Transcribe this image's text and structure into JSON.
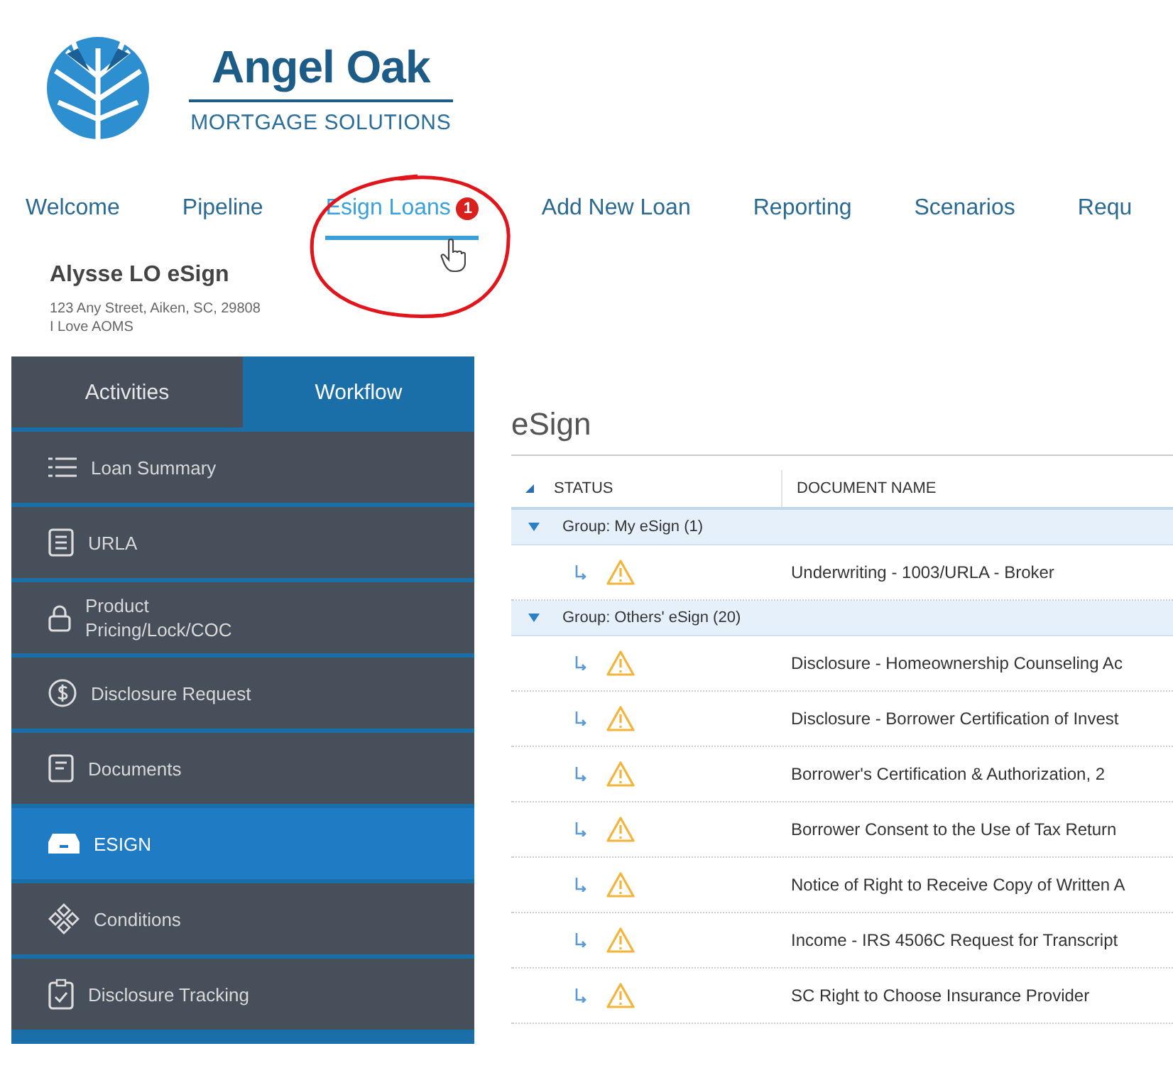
{
  "brand": {
    "name": "Angel Oak",
    "tagline": "MORTGAGE SOLUTIONS"
  },
  "nav": [
    {
      "label": "Welcome",
      "selected": false
    },
    {
      "label": "Pipeline",
      "selected": false
    },
    {
      "label": "Esign Loans",
      "selected": true,
      "badge": "1"
    },
    {
      "label": "Add New Loan",
      "selected": false
    },
    {
      "label": "Reporting",
      "selected": false
    },
    {
      "label": "Scenarios",
      "selected": false
    },
    {
      "label": "Requ",
      "selected": false
    }
  ],
  "user": {
    "name": "Alysse LO eSign",
    "address": "123 Any Street, Aiken, SC, 29808",
    "note": "I Love AOMS"
  },
  "sidebar": {
    "tabs": [
      {
        "label": "Activities",
        "selected": false
      },
      {
        "label": "Workflow",
        "selected": true
      }
    ],
    "items": [
      {
        "label": "Loan Summary",
        "selected": false
      },
      {
        "label": "URLA",
        "selected": false
      },
      {
        "label": "Product\nPricing/Lock/COC",
        "selected": false
      },
      {
        "label": "Disclosure Request",
        "selected": false
      },
      {
        "label": "Documents",
        "selected": false
      },
      {
        "label": "ESIGN",
        "selected": true
      },
      {
        "label": "Conditions",
        "selected": false
      },
      {
        "label": "Disclosure Tracking",
        "selected": false
      }
    ]
  },
  "page_title": "eSign",
  "table": {
    "columns": [
      "STATUS",
      "DOCUMENT NAME"
    ],
    "groups": [
      {
        "label": "Group: My eSign (1)",
        "expanded": true,
        "rows": [
          "Underwriting - 1003/URLA - Broker"
        ]
      },
      {
        "label": "Group: Others' eSign (20)",
        "expanded": true,
        "rows": [
          "Disclosure - Homeownership Counseling Ac",
          "Disclosure - Borrower Certification of Invest",
          "Borrower's Certification & Authorization, 2",
          "Borrower Consent to the Use of Tax Return",
          "Notice of Right to Receive Copy of Written A",
          "Income - IRS 4506C Request for Transcript",
          "SC Right to Choose Insurance Provider"
        ]
      }
    ]
  }
}
